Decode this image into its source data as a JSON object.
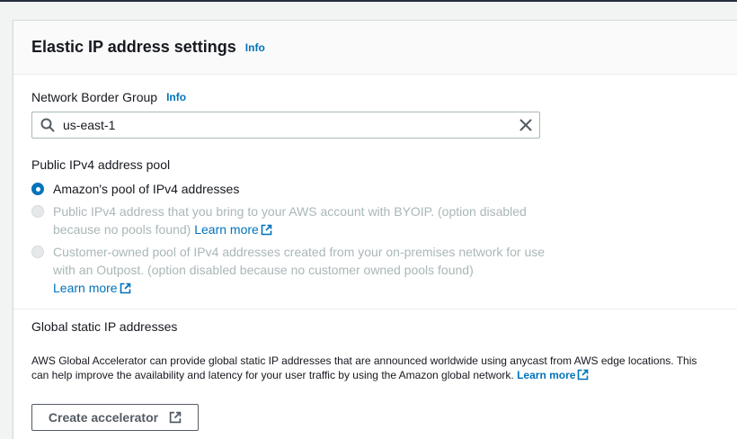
{
  "panel": {
    "title": "Elastic IP address settings",
    "info_label": "Info"
  },
  "network_border_group": {
    "label": "Network Border Group",
    "info_label": "Info",
    "value": "us-east-1"
  },
  "ipv4_pool": {
    "label": "Public IPv4 address pool",
    "options": [
      {
        "text": "Amazon's pool of IPv4 addresses",
        "selected": true,
        "disabled": false
      },
      {
        "text": "Public IPv4 address that you bring to your AWS account with BYOIP. (option disabled because no pools found)",
        "link": "Learn more",
        "selected": false,
        "disabled": true
      },
      {
        "text": "Customer-owned pool of IPv4 addresses created from your on-premises network for use with an Outpost. (option disabled because no customer owned pools found)",
        "link": "Learn more",
        "selected": false,
        "disabled": true
      }
    ]
  },
  "global_static": {
    "label": "Global static IP addresses",
    "description": "AWS Global Accelerator can provide global static IP addresses that are announced worldwide using anycast from AWS edge locations. This can help improve the availability and latency for your user traffic by using the Amazon global network.",
    "link": "Learn more",
    "button_label": "Create accelerator"
  },
  "icons": {
    "search": "search-icon",
    "clear": "close-icon",
    "external": "external-link-icon"
  },
  "colors": {
    "link": "#0073bb",
    "radio_selected": "#0073bb",
    "disabled_text": "#aab7b8"
  }
}
